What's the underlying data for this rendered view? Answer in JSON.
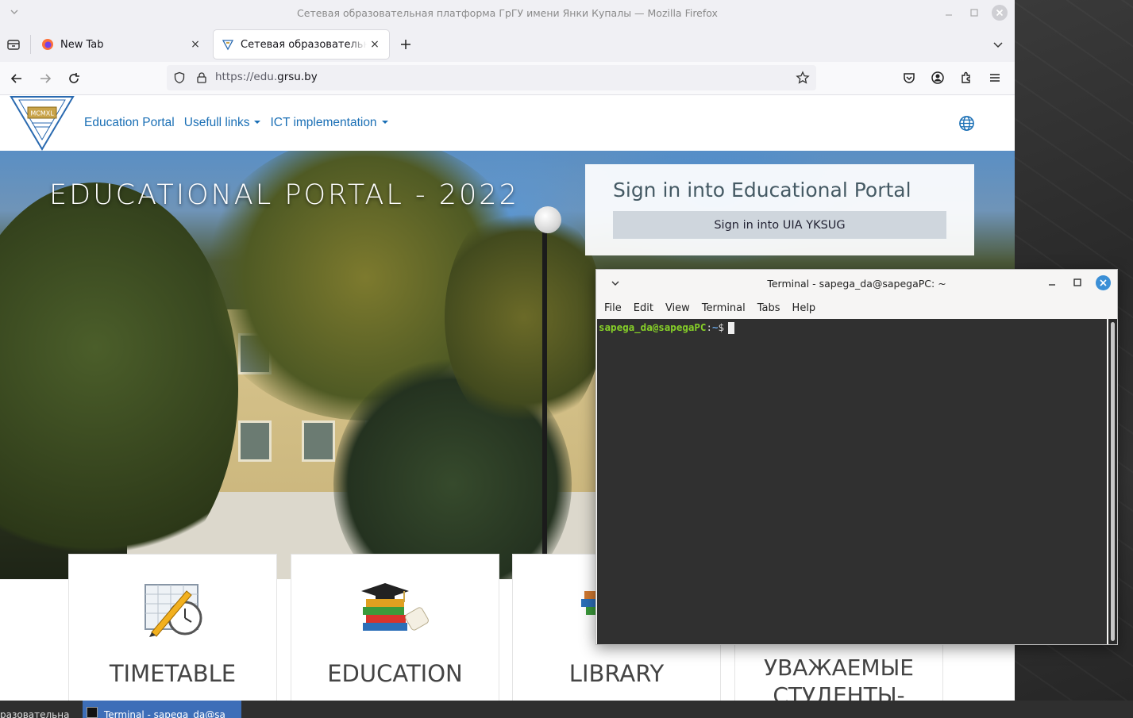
{
  "firefox": {
    "window_title": "Сетевая образовательная платформа ГрГУ имени Янки Купалы — Mozilla Firefox",
    "tabs": [
      {
        "label": "New Tab",
        "close": "×"
      },
      {
        "label": "Сетевая образовательная платформа",
        "close": "×"
      }
    ],
    "new_tab": "+",
    "url": {
      "prefix": "https://edu.",
      "host": "grsu.by"
    }
  },
  "site": {
    "logo_text": "MCMXL",
    "nav": [
      {
        "label": "Education Portal"
      },
      {
        "label": "Usefull links"
      },
      {
        "label": "ICT implementation"
      }
    ],
    "hero_title": "EDUCATIONAL PORTAL - 2022",
    "signin": {
      "title": "Sign in into Educational Portal",
      "button": "Sign in into UIA YKSUG"
    },
    "cards": [
      {
        "label": "TIMETABLE",
        "icon": "timetable-icon"
      },
      {
        "label": "EDUCATION",
        "icon": "books-graduation-icon"
      },
      {
        "label": "LIBRARY",
        "icon": "library-icon"
      },
      {
        "label": "УВАЖАЕМЫЕ СТУДЕНТЫ-",
        "icon": "none"
      }
    ]
  },
  "terminal": {
    "title": "Terminal - sapega_da@sapegaPC: ~",
    "menu": [
      "File",
      "Edit",
      "View",
      "Terminal",
      "Tabs",
      "Help"
    ],
    "prompt_user": "sapega_da@sapegaPC",
    "prompt_sep": ":",
    "prompt_path": "~",
    "prompt_symbol": "$"
  },
  "taskbar": {
    "items": [
      {
        "label": "разовательна"
      },
      {
        "label": "Terminal - sapega_da@sa"
      }
    ]
  },
  "colors": {
    "link_blue": "#1a6fb5",
    "prompt_green": "#87d228",
    "prompt_blue": "#6aa8e8",
    "terminal_bg": "#303030",
    "taskbar_active": "#3d6eb8"
  }
}
